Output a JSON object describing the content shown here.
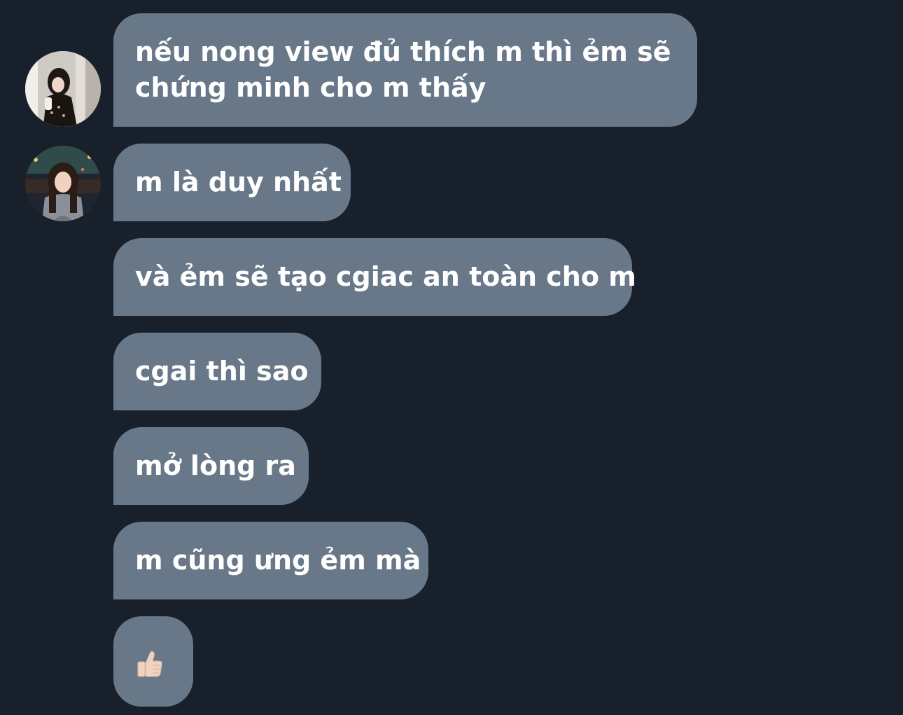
{
  "messages": [
    {
      "text": "nếu nong view đủ thích m thì ẻm sẽ chứng minh cho m thấy"
    },
    {
      "text": "m là duy nhất"
    },
    {
      "text": "và ẻm sẽ tạo cgiac an toàn cho m"
    },
    {
      "text": "cgai thì sao"
    },
    {
      "text": "mở lòng ra"
    },
    {
      "text": "m cũng ưng ẻm mà"
    },
    {
      "emoji": "thumbs-up-icon"
    }
  ],
  "colors": {
    "background": "#17202b",
    "bubble": "#687888",
    "text": "#ffffff"
  }
}
